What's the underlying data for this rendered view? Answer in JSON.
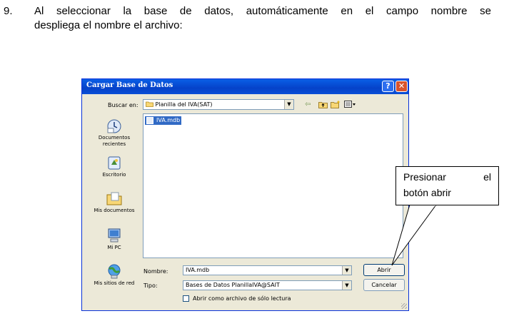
{
  "step": {
    "number": "9.",
    "line1": "Al seleccionar la base de datos, automáticamente en el campo nombre se",
    "line2": "despliega el nombre el archivo:"
  },
  "dialog": {
    "title": "Cargar Base de Datos",
    "help_glyph": "?",
    "close_glyph": "✕",
    "look_in_label": "Buscar en:",
    "look_in_value": "Planilla del IVA(SAT)",
    "places": [
      {
        "label": "Documentos recientes",
        "icon": "recent-documents-icon"
      },
      {
        "label": "Escritorio",
        "icon": "desktop-icon"
      },
      {
        "label": "Mis documentos",
        "icon": "my-documents-icon"
      },
      {
        "label": "Mi PC",
        "icon": "my-computer-icon"
      },
      {
        "label": "Mis sitios de red",
        "icon": "network-places-icon"
      }
    ],
    "files": [
      {
        "name": "IVA.mdb",
        "selected": true
      }
    ],
    "name_label": "Nombre:",
    "name_value": "IVA.mdb",
    "type_label": "Tipo:",
    "type_value": "Bases de Datos PlanillaIVA@SAIT",
    "readonly_label": "Abrir como archivo de sólo lectura",
    "open_button": "Abrir",
    "cancel_button": "Cancelar"
  },
  "callout": {
    "line1_left": "Presionar",
    "line1_right": "el",
    "line2": "botón abrir"
  },
  "colors": {
    "titlebar": "#0542c9",
    "dialog_bg": "#ece9d8",
    "selection": "#316ac5"
  }
}
